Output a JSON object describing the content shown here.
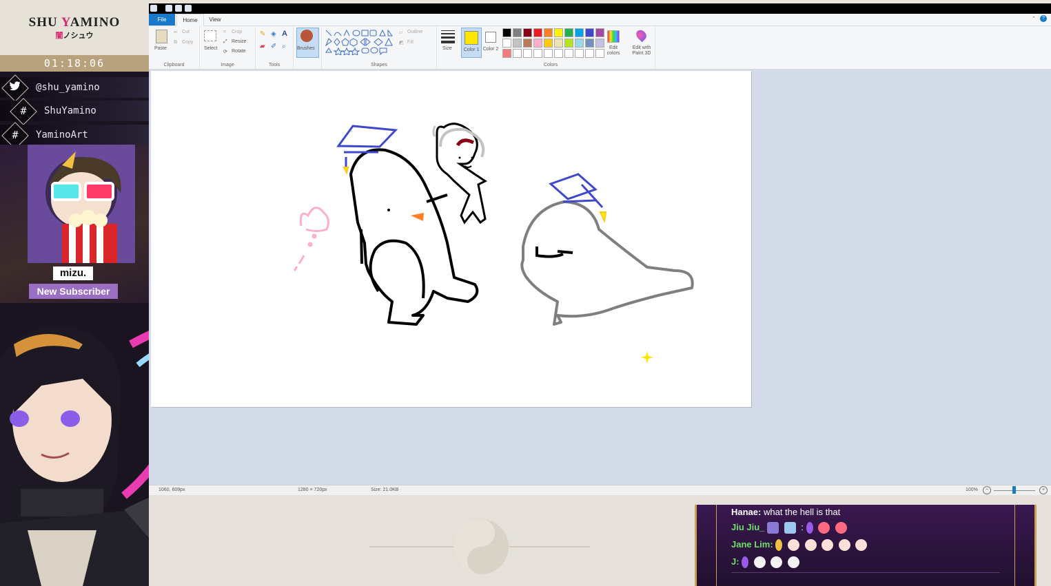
{
  "stream": {
    "channel_title_first": "SHU ",
    "channel_title_y": "Y",
    "channel_title_rest": "AMINO",
    "channel_subtitle_red": "闇",
    "channel_subtitle_rest": "ノシュウ",
    "timer": "01:18:06",
    "socials": [
      {
        "glyph": "twitter-icon",
        "text": "@shu_yamino"
      },
      {
        "glyph": "hash-icon",
        "text": "ShuYamino"
      },
      {
        "glyph": "hash-icon",
        "text": "YaminoArt"
      }
    ],
    "alert": {
      "name": "mizu.",
      "label": "New Subscriber"
    }
  },
  "paint": {
    "menu": {
      "file": "File",
      "home": "Home",
      "view": "View"
    },
    "ribbon": {
      "clipboard": {
        "paste": "Paste",
        "cut": "Cut",
        "copy": "Copy",
        "label": "Clipboard"
      },
      "image": {
        "select": "Select",
        "crop": "Crop",
        "resize": "Resize",
        "rotate": "Rotate",
        "label": "Image"
      },
      "tools": {
        "label": "Tools"
      },
      "brushes": {
        "label": "Brushes"
      },
      "shapes": {
        "outline": "Outline",
        "fill": "Fill",
        "label": "Shapes"
      },
      "size": {
        "label": "Size"
      },
      "color1": {
        "label": "Color 1",
        "value": "#ffe600"
      },
      "color2": {
        "label": "Color 2",
        "value": "#ffffff"
      },
      "colors": {
        "label": "Colors",
        "row1": [
          "#000000",
          "#7f7f7f",
          "#880015",
          "#ed1c24",
          "#ff7f27",
          "#fff200",
          "#22b14c",
          "#00a2e8",
          "#3f48cc",
          "#a349a4"
        ],
        "row2": [
          "#ffffff",
          "#c3c3c3",
          "#b97a57",
          "#ffaec9",
          "#ffc90e",
          "#efe4b0",
          "#b5e61d",
          "#99d9ea",
          "#7092be",
          "#c8bfe7"
        ],
        "row3": [
          "#f57b7b",
          "#ffffff",
          "#ffffff",
          "#ffffff",
          "#ffffff",
          "#ffffff",
          "#ffffff",
          "#ffffff",
          "#ffffff",
          "#ffffff"
        ]
      },
      "edit_colors": "Edit colors",
      "edit_3d": "Edit with Paint 3D"
    },
    "status": {
      "cursor": "1060, 609px",
      "dimensions": "1280 × 720px",
      "size": "Size: 21.0KB",
      "zoom": "100%"
    }
  },
  "chat": [
    {
      "user": "Hanae:",
      "user_color": "#ffffff",
      "message": "what the hell is that"
    },
    {
      "user": "Jiu Jiu_",
      "user_color": "#6ee06a",
      "message": ""
    },
    {
      "user": "Jane Lim:",
      "user_color": "#6ee06a",
      "message": ""
    },
    {
      "user": "J:",
      "user_color": "#6ee06a",
      "message": ""
    }
  ]
}
